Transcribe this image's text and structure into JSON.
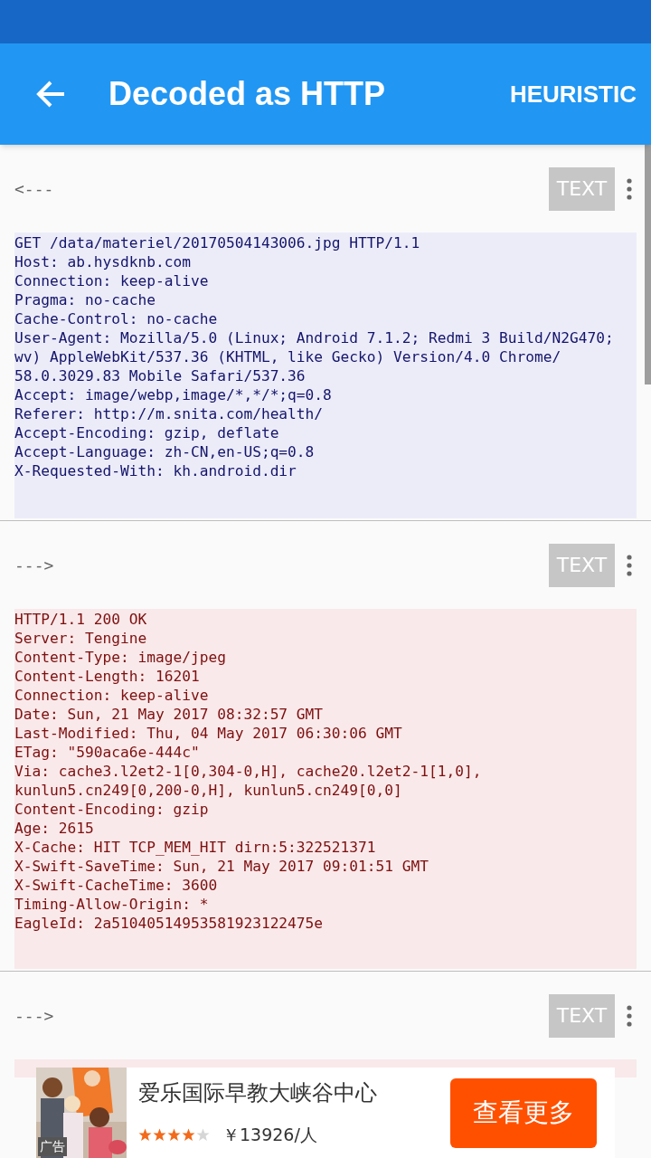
{
  "app_bar": {
    "title": "Decoded as HTTP",
    "action": "HEURISTIC"
  },
  "sections": [
    {
      "direction": "<---",
      "kind": "request",
      "button": "TEXT",
      "lines": [
        "GET /data/materiel/20170504143006.jpg HTTP/1.1",
        "Host: ab.hysdknb.com",
        "Connection: keep-alive",
        "Pragma: no-cache",
        "Cache-Control: no-cache",
        "User-Agent: Mozilla/5.0 (Linux; Android 7.1.2; Redmi 3 Build/N2G470;",
        "wv) AppleWebKit/537.36 (KHTML, like Gecko) Version/4.0 Chrome/",
        "58.0.3029.83 Mobile Safari/537.36",
        "Accept: image/webp,image/*,*/*;q=0.8",
        "Referer: http://m.snita.com/health/",
        "Accept-Encoding: gzip, deflate",
        "Accept-Language: zh-CN,en-US;q=0.8",
        "X-Requested-With: kh.android.dir"
      ]
    },
    {
      "direction": "--->",
      "kind": "response",
      "button": "TEXT",
      "lines": [
        "HTTP/1.1 200 OK",
        "Server: Tengine",
        "Content-Type: image/jpeg",
        "Content-Length: 16201",
        "Connection: keep-alive",
        "Date: Sun, 21 May 2017 08:32:57 GMT",
        "Last-Modified: Thu, 04 May 2017 06:30:06 GMT",
        "ETag: \"590aca6e-444c\"",
        "Via: cache3.l2et2-1[0,304-0,H], cache20.l2et2-1[1,0],",
        "kunlun5.cn249[0,200-0,H], kunlun5.cn249[0,0]",
        "Content-Encoding: gzip",
        "Age: 2615",
        "X-Cache: HIT TCP_MEM_HIT dirn:5:322521371",
        "X-Swift-SaveTime: Sun, 21 May 2017 09:01:51 GMT",
        "X-Swift-CacheTime: 3600",
        "Timing-Allow-Origin: *",
        "EagleId: 2a51040514953581923122475e"
      ]
    },
    {
      "direction": "--->",
      "kind": "response",
      "button": "TEXT"
    }
  ],
  "ad": {
    "label": "广告",
    "title": "爱乐国际早教大峡谷中心",
    "stars": 4,
    "price": "￥13926/人",
    "button": "查看更多"
  }
}
